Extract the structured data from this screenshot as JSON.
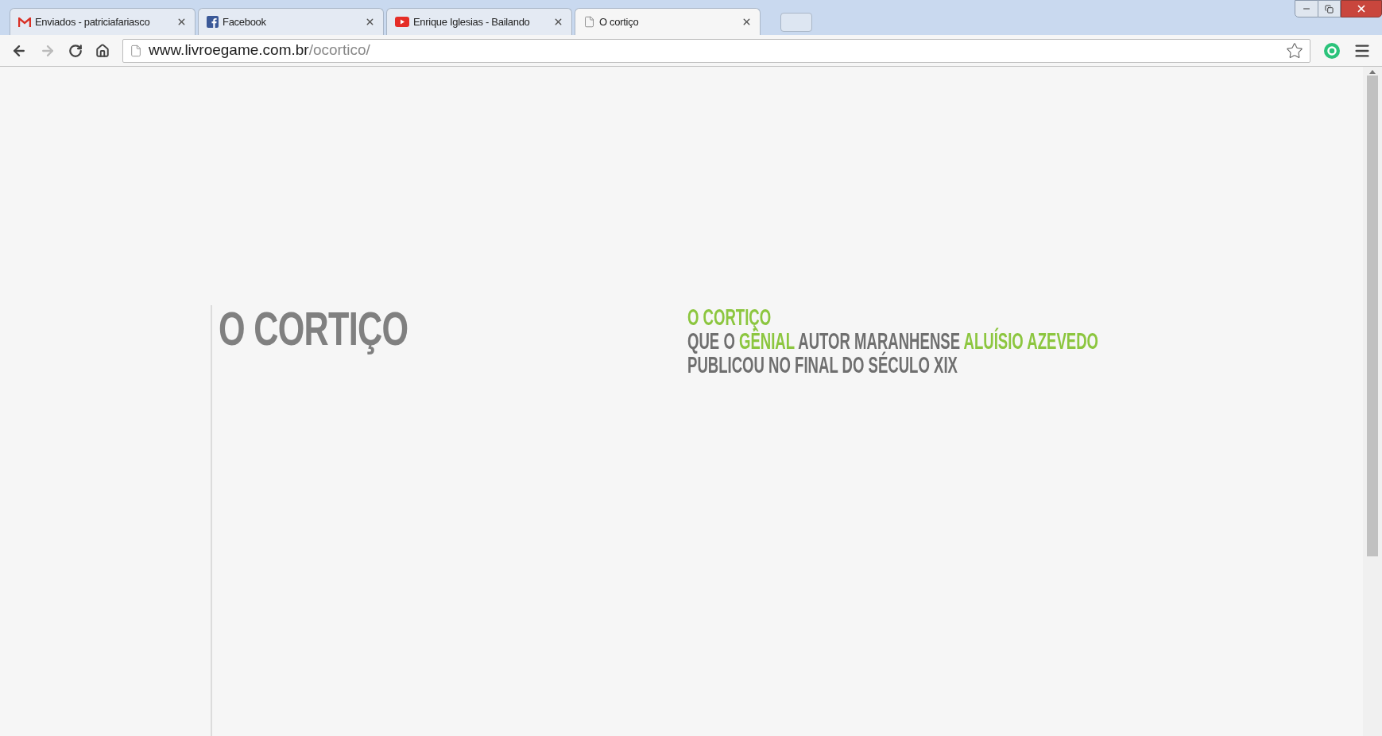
{
  "tabs": [
    {
      "title": "Enviados - patriciafariasco",
      "kind": "gmail",
      "selected": false
    },
    {
      "title": "Facebook",
      "kind": "facebook",
      "selected": false
    },
    {
      "title": "Enrique Iglesias - Bailando",
      "kind": "youtube",
      "selected": false
    },
    {
      "title": "O cortiço",
      "kind": "page",
      "selected": true
    }
  ],
  "address_bar": {
    "domain": "www.livroegame.com.br",
    "path": "/ocortico/"
  },
  "page": {
    "title": "O CORTIÇO",
    "lines": [
      [
        {
          "text": "O CORTIÇO",
          "highlight": true
        }
      ],
      [
        {
          "text": "QUE O ",
          "highlight": false
        },
        {
          "text": "GÊNIAL",
          "highlight": true
        },
        {
          "text": " AUTOR MARANHENSE ",
          "highlight": false
        },
        {
          "text": "ALUÍSIO AZEVEDO",
          "highlight": true
        }
      ],
      [
        {
          "text": "PUBLICOU NO FINAL DO SÉCULO XIX",
          "highlight": false
        }
      ]
    ]
  }
}
